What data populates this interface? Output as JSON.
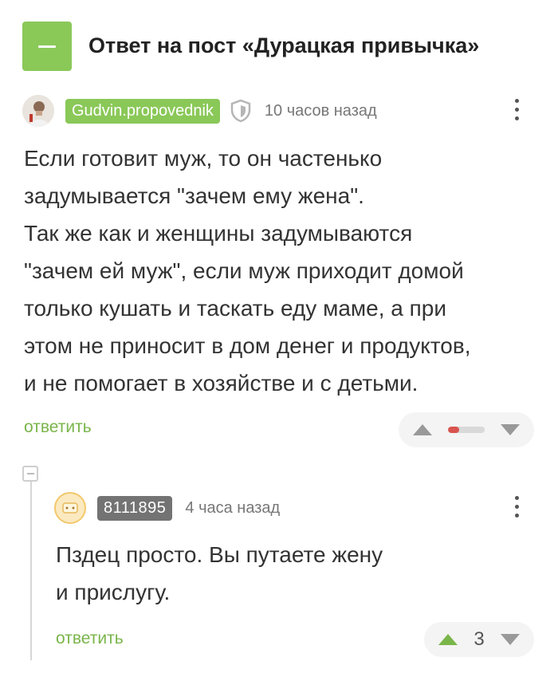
{
  "post": {
    "title": "Ответ на пост «Дурацкая привычка»"
  },
  "colors": {
    "accent_green": "#8ac858",
    "link_green": "#7ab54a",
    "downvote_red": "#d9534f"
  },
  "icons": {
    "collapse": "minus-icon",
    "shield": "shield-icon",
    "menu": "more-vertical-icon",
    "upvote": "triangle-up-icon",
    "downvote": "triangle-down-icon"
  },
  "comments": [
    {
      "author": "Gudvin.propovednik",
      "time": "10 часов назад",
      "text": "Если готовит муж, то он частенько\nзадумывается \"зачем ему жена\".\nТак же как и женщины задумываются\n\"зачем ей муж\", если муж приходит домой\nтолько кушать и таскать еду маме, а при\nэтом не приносит в дом денег и продуктов,\nи не помогает в хозяйстве и с детьми.",
      "reply_label": "ответить",
      "rating_fraction": 0.3
    },
    {
      "author": "8111895",
      "time": "4 часа назад",
      "text": "Пздец просто. Вы путаете жену\nи прислугу.",
      "reply_label": "ответить",
      "score": "3"
    }
  ]
}
